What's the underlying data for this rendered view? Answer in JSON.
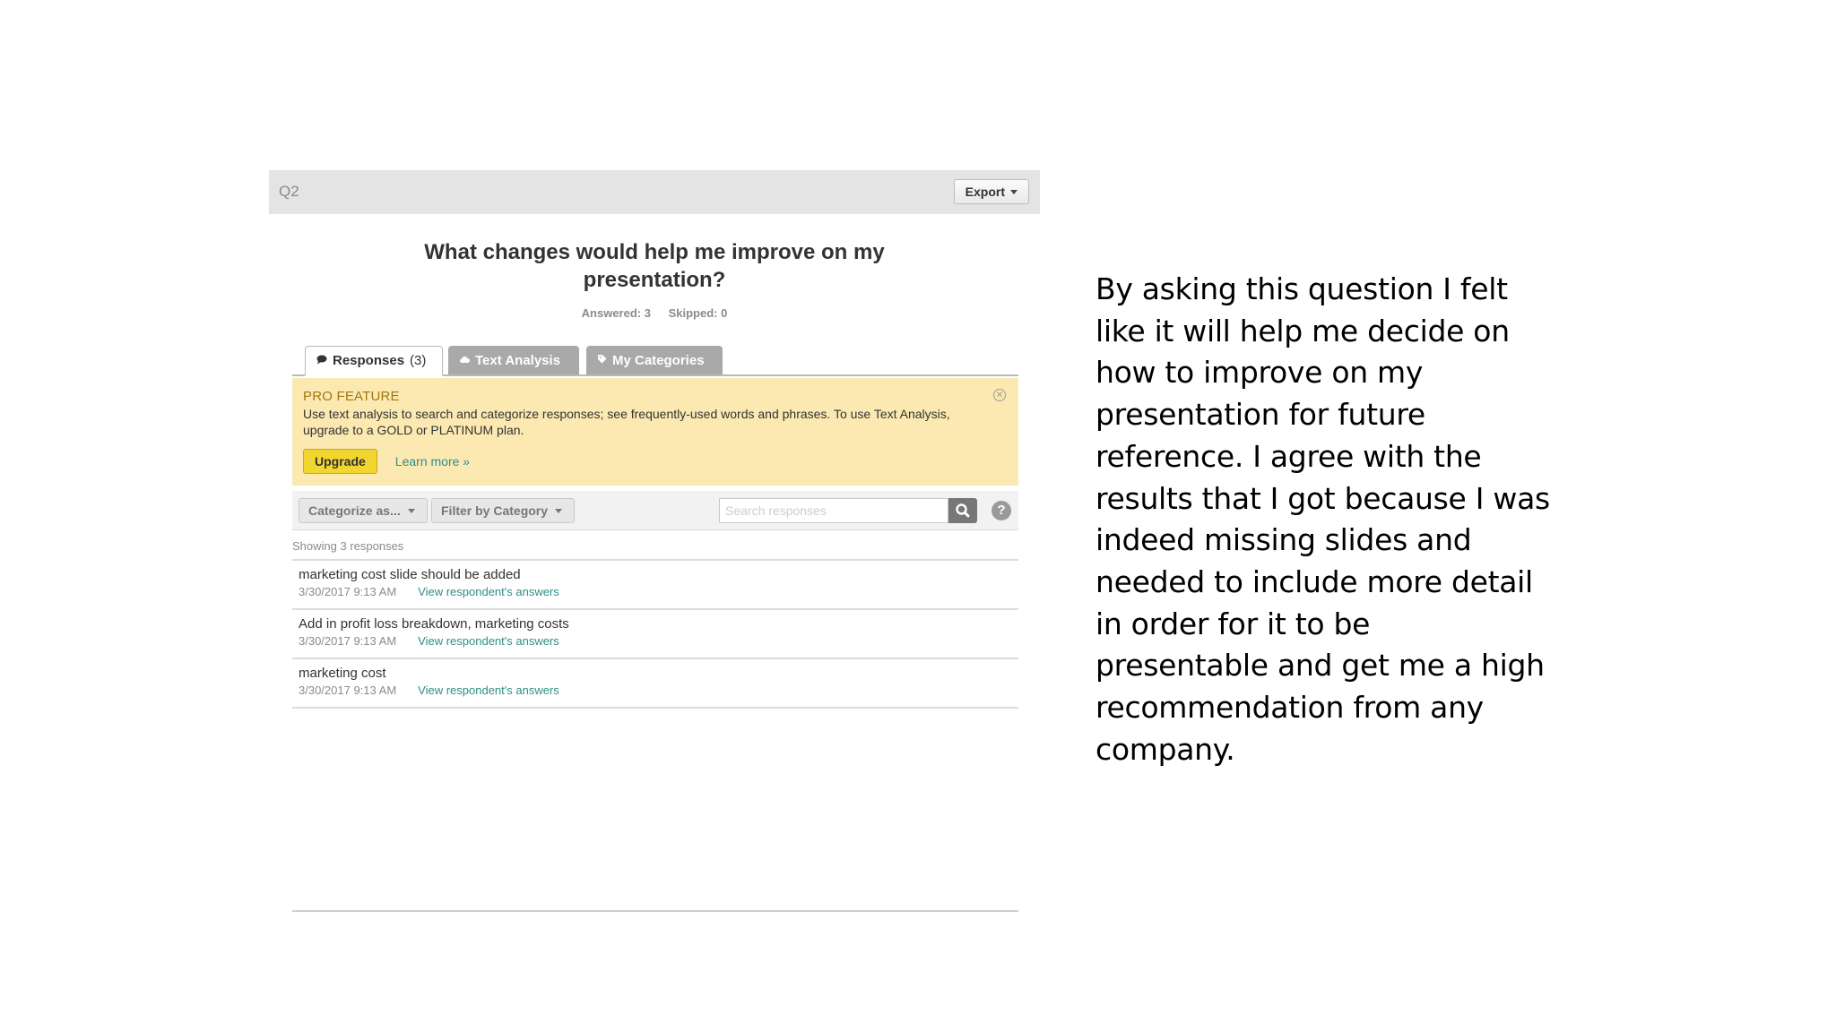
{
  "panel": {
    "question_label": "Q2",
    "export_label": "Export",
    "question_title": "What changes would help me improve on my presentation?",
    "answered": "Answered: 3",
    "skipped": "Skipped: 0",
    "tabs": [
      {
        "label": "Responses",
        "count": "(3)",
        "icon": "speech-bubble-icon",
        "active": true
      },
      {
        "label": "Text Analysis",
        "icon": "cloud-icon",
        "active": false
      },
      {
        "label": "My Categories",
        "icon": "tag-icon",
        "active": false
      }
    ],
    "pro_feature": {
      "title": "PRO FEATURE",
      "text": "Use text analysis to search and categorize responses; see frequently-used words and phrases. To use Text Analysis, upgrade to a GOLD or PLATINUM plan.",
      "upgrade_label": "Upgrade",
      "learn_more_label": "Learn more »"
    },
    "toolbar": {
      "categorize_label": "Categorize as...",
      "filter_label": "Filter by Category",
      "search_placeholder": "Search responses"
    },
    "showing_text": "Showing 3 responses",
    "responses": [
      {
        "text": "marketing cost slide should be added",
        "timestamp": "3/30/2017 9:13 AM",
        "link": "View respondent's answers"
      },
      {
        "text": "Add in profit loss breakdown, marketing costs",
        "timestamp": "3/30/2017 9:13 AM",
        "link": "View respondent's answers"
      },
      {
        "text": "marketing cost",
        "timestamp": "3/30/2017 9:13 AM",
        "link": "View respondent's answers"
      }
    ]
  },
  "narrative": {
    "lines": [
      "By asking this question I felt",
      "like it will help me decide on",
      "how to improve on my",
      "presentation for future",
      "reference. I agree with the",
      "results that I got because I was",
      "indeed missing slides and",
      "needed to include more detail",
      "in order for it to be",
      "presentable and get me a high",
      "recommendation from any",
      "company."
    ]
  },
  "colors": {
    "header_bg": "#e4e4e4",
    "pro_bg": "#fbe9b1",
    "pro_title": "#a5760e",
    "upgrade_bg": "#f2d630",
    "link": "#2d8f8a",
    "inactive_tab": "#a9a9a9"
  }
}
